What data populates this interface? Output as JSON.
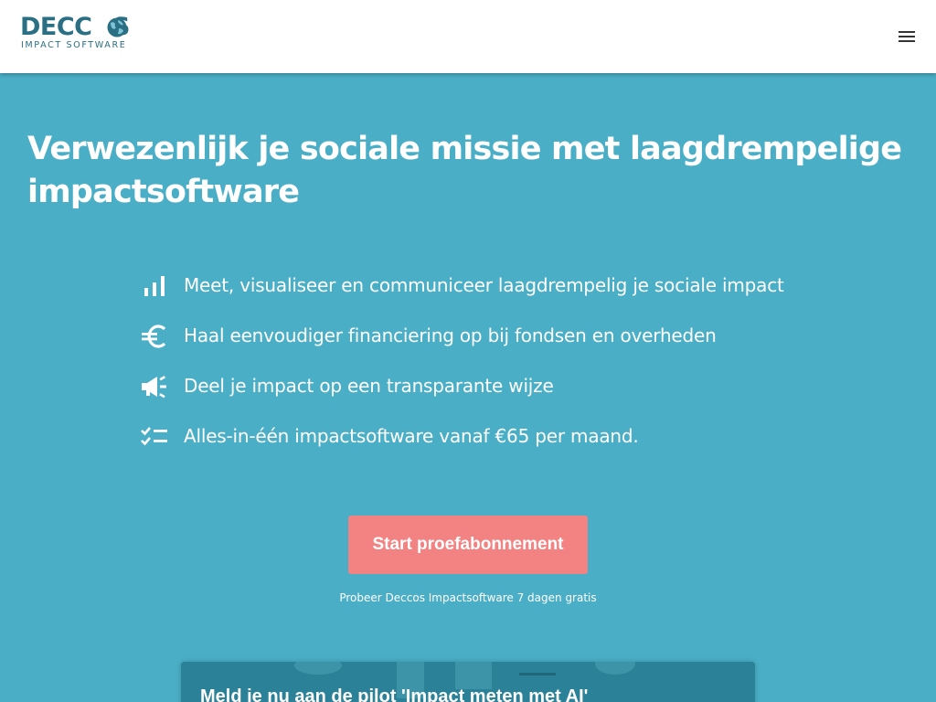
{
  "header": {
    "logo_text": "DECCOS",
    "logo_subtitle": "IMPACT SOFTWARE",
    "menu_icon": "hamburger-menu-icon"
  },
  "hero": {
    "title": "Verwezenlijk je sociale missie met laagdrempelige impactsoftware",
    "features": [
      {
        "icon": "bar-chart-icon",
        "text": "Meet, visualiseer en communiceer laagdrempelig je sociale impact"
      },
      {
        "icon": "euro-icon",
        "text": "Haal eenvoudiger financiering op bij fondsen en overheden"
      },
      {
        "icon": "megaphone-icon",
        "text": "Deel je impact op een transparante wijze"
      },
      {
        "icon": "checklist-icon",
        "text": "Alles-in-één impactsoftware vanaf €65 per maand."
      }
    ],
    "cta_label": "Start proefabonnement",
    "cta_subtext": "Probeer Deccos Impactsoftware 7 dagen gratis"
  },
  "pilot": {
    "title": "Meld je nu aan de pilot 'Impact meten met AI'"
  },
  "colors": {
    "background": "#4aaec6",
    "brand": "#2b6f84",
    "cta": "#f38383",
    "card": "#2b8197"
  }
}
